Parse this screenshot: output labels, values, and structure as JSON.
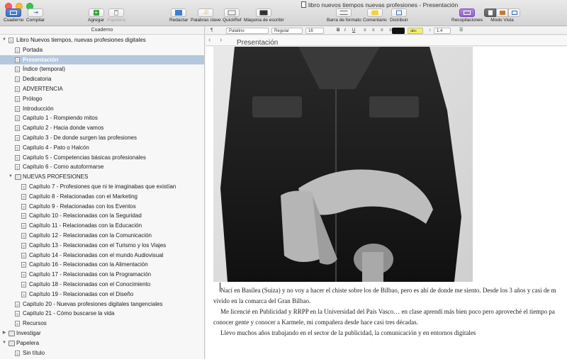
{
  "window": {
    "title": "libro nuevos tiempos nuevas profesiones - Presentación"
  },
  "toolbar": {
    "cuaderno": "Cuaderno",
    "compilar": "Compilar",
    "agregar": "Agregar",
    "papelera": "Papelera",
    "redactar": "Redactar",
    "palabras_clave": "Palabras clave",
    "quickref": "QuickRef",
    "maquina": "Máquina de escribir",
    "barra_formato": "Barra de formato",
    "comentario": "Comentario",
    "distribuir": "Distribuir",
    "recopilaciones": "Recopilaciones",
    "modo_vista": "Modo Vista"
  },
  "binder": {
    "header": "Cuaderno",
    "items": [
      {
        "label": "Libro Nuevos tiempos, nuevas profesiones digitales",
        "depth": 0,
        "kind": "book",
        "disclosure": "▼"
      },
      {
        "label": "Portada",
        "depth": 1,
        "kind": "page"
      },
      {
        "label": "Presentación",
        "depth": 1,
        "kind": "page",
        "selected": true
      },
      {
        "label": "Índice (temporal)",
        "depth": 1,
        "kind": "page"
      },
      {
        "label": "Dedicatoria",
        "depth": 1,
        "kind": "page"
      },
      {
        "label": "ADVERTENCIA",
        "depth": 1,
        "kind": "page"
      },
      {
        "label": "Prólogo",
        "depth": 1,
        "kind": "page"
      },
      {
        "label": "Introducción",
        "depth": 1,
        "kind": "page"
      },
      {
        "label": "Capítulo 1 - Rompiendo mitos",
        "depth": 1,
        "kind": "page"
      },
      {
        "label": "Capítulo 2 - Hacia donde vamos",
        "depth": 1,
        "kind": "page"
      },
      {
        "label": "Capítulo 3 - De donde surgen las profesiones",
        "depth": 1,
        "kind": "page"
      },
      {
        "label": "Capítulo 4 - Pato o Halcón",
        "depth": 1,
        "kind": "page"
      },
      {
        "label": "Capítulo 5 - Competencias básicas profesionales",
        "depth": 1,
        "kind": "page"
      },
      {
        "label": "Capítulo 6 - Como autoformarse",
        "depth": 1,
        "kind": "page"
      },
      {
        "label": "NUEVAS PROFESIONES",
        "depth": 1,
        "kind": "folder",
        "disclosure": "▼"
      },
      {
        "label": "Capítulo 7 - Profesiones que ni te imaginabas que existían",
        "depth": 2,
        "kind": "page"
      },
      {
        "label": "Capítulo 8 - Relacionadas con el Marketing",
        "depth": 2,
        "kind": "page"
      },
      {
        "label": "Capítulo 9 - Relacionadas con los Eventos",
        "depth": 2,
        "kind": "page"
      },
      {
        "label": "Capítulo 10 - Relacionadas con la Seguridad",
        "depth": 2,
        "kind": "page"
      },
      {
        "label": "Capítulo 11 - Relacionadas con la Educación",
        "depth": 2,
        "kind": "page"
      },
      {
        "label": "Capítulo 12 - Relacionadas con la Comunicación",
        "depth": 2,
        "kind": "page"
      },
      {
        "label": "Capítulo 13 - Relacionadas con el Turismo y los Viajes",
        "depth": 2,
        "kind": "page"
      },
      {
        "label": "Capítulo 14 - Relacionadas con el mundo Audiovisual",
        "depth": 2,
        "kind": "page"
      },
      {
        "label": "Capítulo 16 - Relacionadas con la Alimentación",
        "depth": 2,
        "kind": "page"
      },
      {
        "label": "Capítulo 17 - Relacionadas con la Programación",
        "depth": 2,
        "kind": "page"
      },
      {
        "label": "Capítulo 18 - Relacionadas con el Conocimiento",
        "depth": 2,
        "kind": "page"
      },
      {
        "label": "Capítulo 19 - Relacionadas con el Diseño",
        "depth": 2,
        "kind": "page"
      },
      {
        "label": "Capítulo 20 - Nuevas profesiones digitales tangenciales",
        "depth": 1,
        "kind": "page"
      },
      {
        "label": "Capítulo 21 - Cómo buscarse la vida",
        "depth": 1,
        "kind": "page"
      },
      {
        "label": "Recursos",
        "depth": 1,
        "kind": "page"
      },
      {
        "label": "Investigar",
        "depth": 0,
        "kind": "folder",
        "disclosure": "▶"
      },
      {
        "label": "Papelera",
        "depth": 0,
        "kind": "folder",
        "disclosure": "▼"
      },
      {
        "label": "Sin título",
        "depth": 1,
        "kind": "page"
      }
    ]
  },
  "formatbar": {
    "paragraph_style": "¶",
    "font_family": "Palatino",
    "font_style": "Regular",
    "font_size": "16",
    "bold": "B",
    "italic": "I",
    "underline": "U",
    "highlight_label": "abc",
    "line_spacing": "1.4"
  },
  "header": {
    "title": "Presentación"
  },
  "document": {
    "paragraphs": [
      "Nací en Basilea (Suiza) y no voy a hacer el chiste sobre los de Bilbao, pero es ahí de donde me siento. Desde los 3 años y casi de m",
      "vivido en la comarca del Gran Bilbao.",
      "Me licencié en Publicidad y RRPP en la Universidad del País Vasco… en clase aprendí más bien poco pero aproveché el tiempo pa",
      "conocer gente y conocer a Karmele, mi compañera desde hace casi tres décadas.",
      "Llevo muchos años trabajando en el sector de la publicidad, la comunicación y en entornos digitales"
    ]
  },
  "colors": {
    "selection": "#b4c7dd",
    "sidebar_bg": "#f7f7f7",
    "toolbar_bg": "#dcdcdc"
  }
}
